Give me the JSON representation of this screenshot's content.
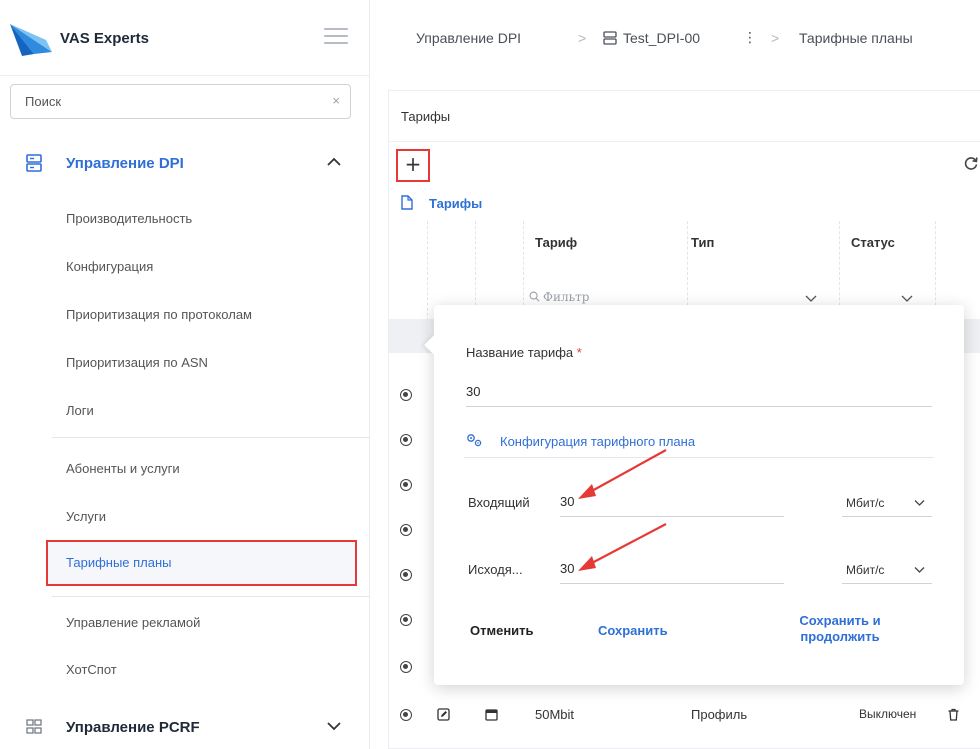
{
  "brand": {
    "name": "VAS Experts"
  },
  "sidebar": {
    "search_placeholder": "Поиск",
    "clear_symbol": "×",
    "dpi_group_label": "Управление DPI",
    "items": [
      "Производительность",
      "Конфигурация",
      "Приоритизация по протоколам",
      "Приоритизация по ASN",
      "Логи",
      "Абоненты и услуги",
      "Услуги",
      "Тарифные планы",
      "Управление рекламой",
      "ХотСпот"
    ],
    "pcrf_group_label": "Управление PCRF"
  },
  "breadcrumb": {
    "root": "Управление DPI",
    "sep": ">",
    "device": "Test_DPI-00",
    "more": "⋮",
    "current": "Тарифные планы"
  },
  "panel": {
    "title": "Тарифы",
    "add_symbol": "+",
    "tree_label": "Тарифы",
    "columns": {
      "tariff": "Тариф",
      "type": "Тип",
      "status": "Статус"
    },
    "filter_placeholder": "Фильтр",
    "last_row": {
      "tariff": "50Mbit",
      "type": "Профиль",
      "status": "Выключен"
    }
  },
  "popup": {
    "name_label": "Название тарифа",
    "required_mark": "*",
    "name_value": "30",
    "config_link": "Конфигурация тарифного плана",
    "incoming_label": "Входящий",
    "incoming_value": "30",
    "incoming_unit": "Мбит/с",
    "outgoing_label": "Исходя...",
    "outgoing_value": "30",
    "outgoing_unit": "Мбит/с",
    "cancel_label": "Отменить",
    "save_label": "Сохранить",
    "save_continue_label": "Сохранить и продолжить"
  },
  "colors": {
    "accent": "#2f6fd6",
    "highlight": "#e53935",
    "text": "#2b2b2b"
  }
}
